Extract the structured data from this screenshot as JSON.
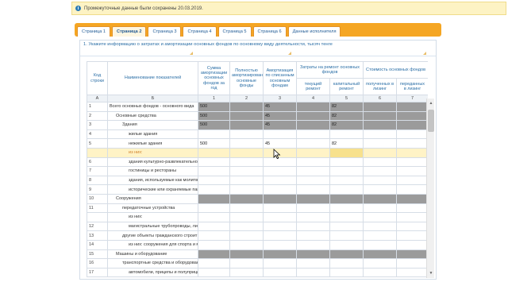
{
  "notice": {
    "icon": "info-icon",
    "text": "Промежуточные данные были сохранены 20.03.2019."
  },
  "tabs": [
    {
      "label": "Страница 1"
    },
    {
      "label": "Страница 2"
    },
    {
      "label": "Страница 3"
    },
    {
      "label": "Страница 4"
    },
    {
      "label": "Страница 5"
    },
    {
      "label": "Страница 6"
    },
    {
      "label": "Данные исполнителя"
    }
  ],
  "active_tab": "Страница 2",
  "section_title": "1. Укажите информацию о затратах и амортизации основных фондов по основному виду деятельности, тысяч тенге",
  "table": {
    "headers": {
      "code": "Код строки",
      "name": "Наименование показателей",
      "amort_sum": "Сумма амортизации основных фондов за год",
      "fully_amort": "Полностью амортизированные основные фонды",
      "amort_written": "Амортизация по списанным основным фондам",
      "repair": "Затраты на ремонт основных фондов",
      "repair_current": "текущий ремонт",
      "repair_capital": "капитальный ремонт",
      "value": "Стоимость основных фондов",
      "value_received": "полученных в лизинг",
      "value_transferred": "переданных в лизинг"
    },
    "index_row": [
      "А",
      "Б",
      "1",
      "2",
      "3",
      "4",
      "5",
      "6",
      "7"
    ],
    "rows": [
      {
        "code": "1",
        "name": "Всего основных фондов  - основного  вида",
        "c1": "500",
        "c2": "",
        "c3": "45",
        "c4": "",
        "c5": "82",
        "c6": "",
        "c7": ""
      },
      {
        "code": "2",
        "name": "Основные средства",
        "c1": "500",
        "c2": "",
        "c3": "45",
        "c4": "",
        "c5": "82",
        "c6": "",
        "c7": ""
      },
      {
        "code": "3",
        "name": "Здания",
        "c1": "500",
        "c2": "",
        "c3": "45",
        "c4": "",
        "c5": "82",
        "c6": "",
        "c7": ""
      },
      {
        "code": "4",
        "name": "жилые здания",
        "c1": "",
        "c2": "",
        "c3": "",
        "c4": "",
        "c5": "",
        "c6": "",
        "c7": ""
      },
      {
        "code": "5",
        "name": "нежилые здания",
        "c1": "500",
        "c2": "",
        "c3": "45",
        "c4": "",
        "c5": "82",
        "c6": "",
        "c7": ""
      },
      {
        "code": "",
        "name": "из них:",
        "c1": "",
        "c2": "",
        "c3": "",
        "c4": "",
        "c5": "",
        "c6": "",
        "c7": ""
      },
      {
        "code": "6",
        "name": "здания культурно-развлекательного",
        "c1": "",
        "c2": "",
        "c3": "",
        "c4": "",
        "c5": "",
        "c6": "",
        "c7": ""
      },
      {
        "code": "7",
        "name": "гостиницы и рестораны",
        "c1": "",
        "c2": "",
        "c3": "",
        "c4": "",
        "c5": "",
        "c6": "",
        "c7": ""
      },
      {
        "code": "8",
        "name": "здания, используемые как молитве",
        "c1": "",
        "c2": "",
        "c3": "",
        "c4": "",
        "c5": "",
        "c6": "",
        "c7": ""
      },
      {
        "code": "9",
        "name": "исторические или охраняемые пам",
        "c1": "",
        "c2": "",
        "c3": "",
        "c4": "",
        "c5": "",
        "c6": "",
        "c7": ""
      },
      {
        "code": "10",
        "name": "Сооружения",
        "c1": "",
        "c2": "",
        "c3": "",
        "c4": "",
        "c5": "",
        "c6": "",
        "c7": ""
      },
      {
        "code": "11",
        "name": "передаточные устройства",
        "c1": "",
        "c2": "",
        "c3": "",
        "c4": "",
        "c5": "",
        "c6": "",
        "c7": ""
      },
      {
        "code": "",
        "name": "из них:",
        "c1": "",
        "c2": "",
        "c3": "",
        "c4": "",
        "c5": "",
        "c6": "",
        "c7": ""
      },
      {
        "code": "12",
        "name": "магистральные трубопроводы, линии",
        "c1": "",
        "c2": "",
        "c3": "",
        "c4": "",
        "c5": "",
        "c6": "",
        "c7": ""
      },
      {
        "code": "13",
        "name": "другие объекты гражданского строит",
        "c1": "",
        "c2": "",
        "c3": "",
        "c4": "",
        "c5": "",
        "c6": "",
        "c7": ""
      },
      {
        "code": "14",
        "name": "из них: сооружения  для спорта и ме",
        "c1": "",
        "c2": "",
        "c3": "",
        "c4": "",
        "c5": "",
        "c6": "",
        "c7": ""
      },
      {
        "code": "15",
        "name": "Машины и оборудование",
        "c1": "",
        "c2": "",
        "c3": "",
        "c4": "",
        "c5": "",
        "c6": "",
        "c7": ""
      },
      {
        "code": "16",
        "name": "транспортные средства и оборудован",
        "c1": "",
        "c2": "",
        "c3": "",
        "c4": "",
        "c5": "",
        "c6": "",
        "c7": ""
      },
      {
        "code": "17",
        "name": "автомобили, прицепы и полуприцеп",
        "c1": "",
        "c2": "",
        "c3": "",
        "c4": "",
        "c5": "",
        "c6": "",
        "c7": ""
      }
    ]
  },
  "colors": {
    "tab_bar": "#f5a623",
    "header_text": "#2a6ea6",
    "disabled_cell": "#9b9b9b",
    "selected_row": "#fff3c6",
    "notice_bg": "#fdf3c4"
  }
}
